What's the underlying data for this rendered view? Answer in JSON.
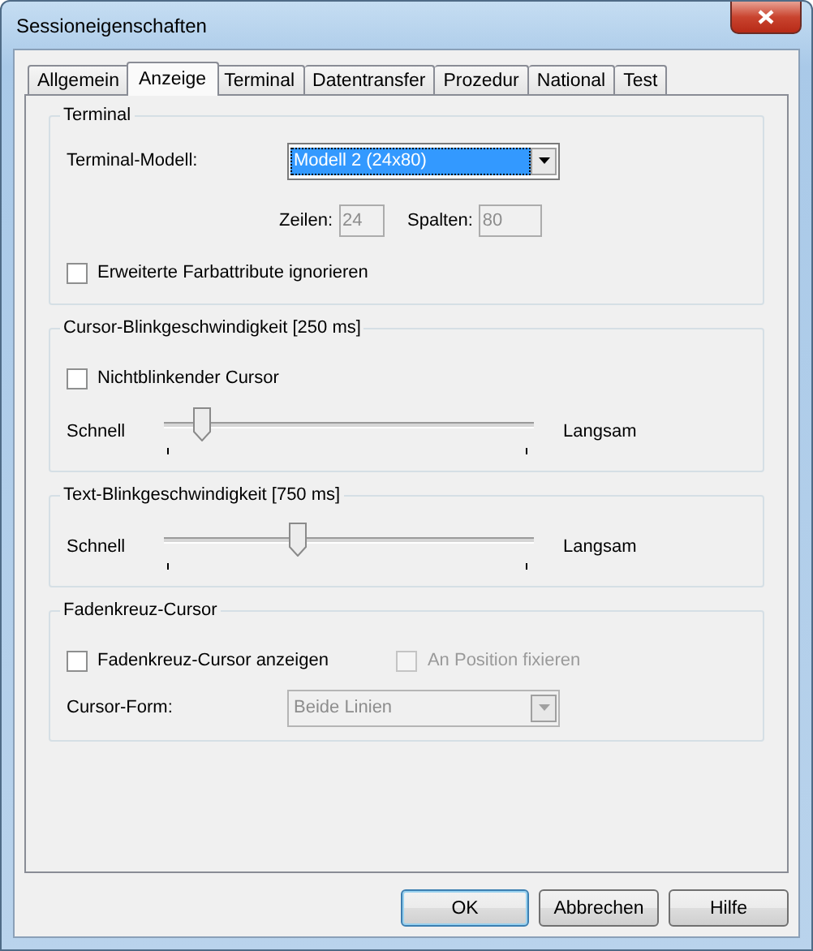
{
  "window": {
    "title": "Sessioneigenschaften"
  },
  "tabs": [
    {
      "label": "Allgemein",
      "selected": false
    },
    {
      "label": "Anzeige",
      "selected": true
    },
    {
      "label": "Terminal",
      "selected": false
    },
    {
      "label": "Datentransfer",
      "selected": false
    },
    {
      "label": "Prozedur",
      "selected": false
    },
    {
      "label": "National",
      "selected": false
    },
    {
      "label": "Test",
      "selected": false
    }
  ],
  "groups": [
    {
      "title": "Terminal",
      "items": [
        {
          "kind": "select",
          "label": "Terminal-Modell:",
          "value": "Modell 2 (24x80)",
          "focused": true,
          "disabled": false
        },
        {
          "kind": "fields",
          "fields": [
            {
              "label": "Zeilen:",
              "value": "24",
              "disabled": true
            },
            {
              "label": "Spalten:",
              "value": "80",
              "disabled": true
            }
          ]
        },
        {
          "kind": "checkboxes",
          "checkboxes": [
            {
              "label": "Erweiterte Farbattribute ignorieren",
              "checked": false,
              "disabled": false
            }
          ]
        }
      ]
    },
    {
      "title": "Cursor-Blinkgeschwindigkeit [250 ms]",
      "items": [
        {
          "kind": "checkboxes",
          "checkboxes": [
            {
              "label": "Nichtblinkender Cursor",
              "checked": false,
              "disabled": false
            }
          ]
        },
        {
          "kind": "slider",
          "min_label": "Schnell",
          "max_label": "Langsam",
          "level": 0.1
        }
      ]
    },
    {
      "title": "Text-Blinkgeschwindigkeit [750 ms]",
      "items": [
        {
          "kind": "slider",
          "min_label": "Schnell",
          "max_label": "Langsam",
          "level": 0.36
        }
      ]
    },
    {
      "title": "Fadenkreuz-Cursor",
      "items": [
        {
          "kind": "checkboxes",
          "checkboxes": [
            {
              "label": "Fadenkreuz-Cursor anzeigen",
              "checked": false,
              "disabled": false
            },
            {
              "label": "An Position fixieren",
              "checked": false,
              "disabled": true
            }
          ]
        },
        {
          "kind": "select",
          "label": "Cursor-Form:",
          "value": "Beide Linien",
          "focused": false,
          "disabled": true
        }
      ]
    }
  ],
  "buttons": [
    {
      "label": "OK",
      "default": true
    },
    {
      "label": "Abbrechen",
      "default": false
    },
    {
      "label": "Hilfe",
      "default": false
    }
  ]
}
